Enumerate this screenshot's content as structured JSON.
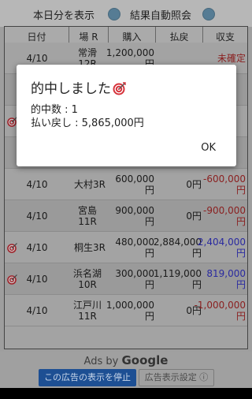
{
  "top_bar": {
    "show_today_label": "本日分を表示",
    "auto_result_label": "結果自動照会"
  },
  "table": {
    "headers": [
      "日付",
      "場 R",
      "購入",
      "払戻",
      "収支"
    ],
    "rows": [
      {
        "date": "4/10",
        "venue": "常滑12R",
        "purchase": "1,200,000 円",
        "payout": "",
        "balance": "未確定",
        "hit": false,
        "balance_color": "neg"
      },
      {
        "date": "",
        "venue": "",
        "purchase": "",
        "payout": "",
        "balance": "",
        "hit": false,
        "balance_color": ""
      },
      {
        "date": "",
        "venue": "",
        "purchase": "",
        "payout": "",
        "balance": "",
        "hit": true,
        "balance_color": ""
      },
      {
        "date": "",
        "venue": "",
        "purchase": "",
        "payout": "",
        "balance": "",
        "hit": false,
        "balance_color": ""
      },
      {
        "date": "4/10",
        "venue": "大村3R",
        "purchase": "600,000円",
        "payout": "0円",
        "balance": "-600,000円",
        "hit": false,
        "balance_color": "neg"
      },
      {
        "date": "4/10",
        "venue": "宮島11R",
        "purchase": "900,000円",
        "payout": "0円",
        "balance": "-900,000円",
        "hit": false,
        "balance_color": "neg"
      },
      {
        "date": "4/10",
        "venue": "桐生3R",
        "purchase": "480,000円",
        "payout": "2,884,000 円",
        "balance": "2,404,000 円",
        "hit": true,
        "balance_color": "pos"
      },
      {
        "date": "4/10",
        "venue": "浜名湖10R",
        "purchase": "300,000円",
        "payout": "1,119,000 円",
        "balance": "819,000円",
        "hit": true,
        "balance_color": "pos"
      },
      {
        "date": "4/10",
        "venue": "江戸川11R",
        "purchase": "1,000,000 円",
        "payout": "0円",
        "balance": "-1,000,000 円",
        "hit": false,
        "balance_color": "neg"
      }
    ]
  },
  "ad_bar": {
    "ads_by": "Ads by",
    "google": "Google",
    "stop_label": "この広告の表示を停止",
    "settings_label": "広告表示設定 ⓘ"
  },
  "dialog": {
    "title": "的中しました",
    "hit_count_line": "的中数 : 1",
    "payout_line": "払い戻し : 5,865,000円",
    "ok_label": "OK"
  },
  "colors": {
    "toggle": "#567c94",
    "negative": "#8a1f1f",
    "positive": "#2a2aa0",
    "stop_button": "#1d4f93"
  }
}
